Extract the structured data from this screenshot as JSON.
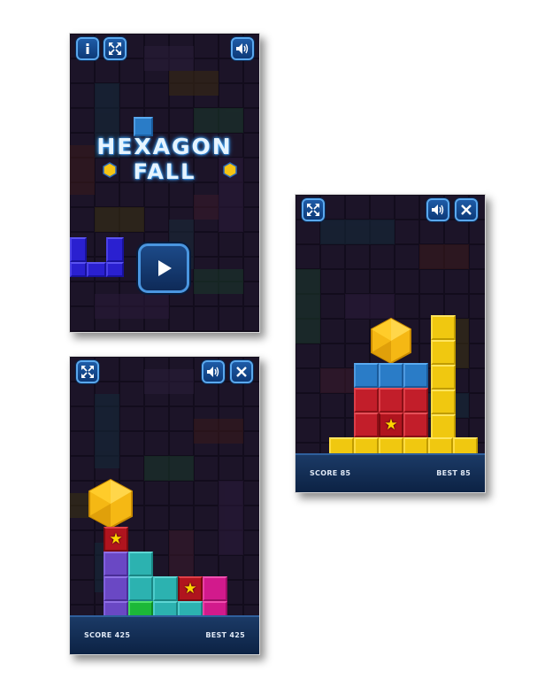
{
  "title_screen": {
    "title_line1": "HEXAGON",
    "title_line2": "FALL",
    "info_button_icon": "info-icon",
    "fullscreen_button_icon": "fullscreen-icon",
    "sound_button_icon": "speaker-icon",
    "play_button_icon": "play-icon"
  },
  "game_screen_a": {
    "score": "SCORE 425",
    "best": "BEST 425",
    "fullscreen_button_icon": "fullscreen-icon",
    "sound_button_icon": "speaker-icon",
    "close_button_icon": "close-icon"
  },
  "game_screen_b": {
    "score": "SCORE 85",
    "best": "BEST 85",
    "fullscreen_button_icon": "fullscreen-icon",
    "sound_button_icon": "speaker-icon",
    "close_button_icon": "close-icon"
  },
  "star_symbol": "★",
  "colors": {
    "background": "#1a1226",
    "blue": "#2a7cc7",
    "red": "#c21e2a",
    "yellow": "#f0c810",
    "purple": "#6a48c4",
    "teal": "#2cb2b0",
    "magenta": "#d21a8c",
    "green": "#1cb838",
    "hexagon": "#f5b814",
    "score_bar": "#0c2244"
  }
}
